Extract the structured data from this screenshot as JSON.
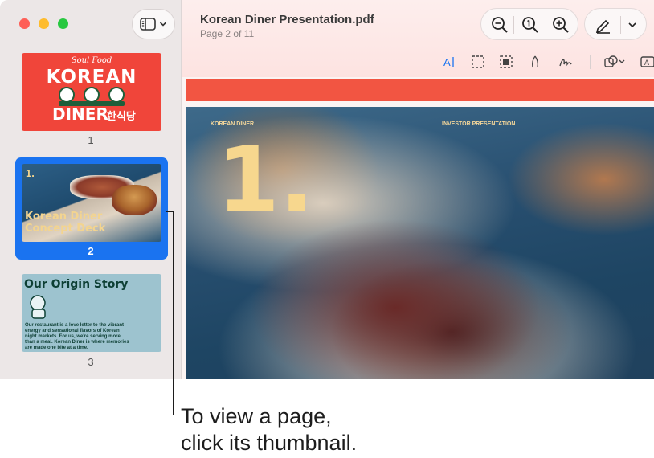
{
  "window": {
    "doc_title": "Korean Diner Presentation.pdf",
    "page_indicator": "Page 2 of 11"
  },
  "sidebar": {
    "thumbnails": [
      {
        "page_label": "1",
        "lines": [
          "Soul Food",
          "KOREAN",
          "DINER",
          "한식당"
        ]
      },
      {
        "page_label": "2",
        "number": "1.",
        "title_line1": "Korean Diner",
        "title_line2": "Concept Deck",
        "selected": true
      },
      {
        "page_label": "3",
        "title": "Our Origin Story",
        "body": "Our restaurant is a love letter to the vibrant energy and sensational flavors of Korean night markets. For us, we're serving more than a meal. Korean Diner is where memories are made one bite at a time."
      }
    ]
  },
  "page_view": {
    "header_left": "KOREAN DINER",
    "header_right": "INVESTOR PRESENTATION",
    "big_number": "1."
  },
  "callout": {
    "line1": "To view a page,",
    "line2": "click its thumbnail."
  },
  "colors": {
    "accent": "#1a73f0",
    "page_red": "#f25542",
    "thumb_yellow": "#f3d48f"
  },
  "icons": [
    "sidebar-icon",
    "chevron-down-icon",
    "zoom-out-icon",
    "actual-size-icon",
    "zoom-in-icon",
    "markup-pen-icon",
    "text-selection-icon",
    "rect-selection-icon",
    "smart-lasso-icon",
    "sketch-icon",
    "signature-icon",
    "shapes-icon",
    "text-box-icon"
  ]
}
